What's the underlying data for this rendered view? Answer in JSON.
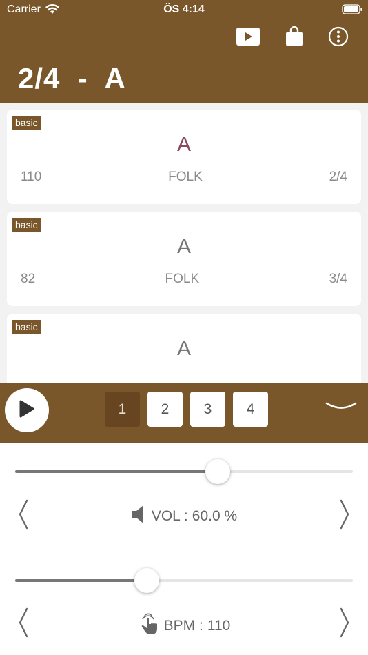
{
  "status": {
    "carrier": "Carrier",
    "time": "ÖS 4:14"
  },
  "header": {
    "title": "2/4  -  A",
    "icons": [
      "video-play-icon",
      "shopping-bag-icon",
      "more-options-icon"
    ]
  },
  "rhythms": [
    {
      "tag": "basic",
      "key": "A",
      "bpm": "110",
      "genre": "FOLK",
      "meter": "2/4",
      "active": true
    },
    {
      "tag": "basic",
      "key": "A",
      "bpm": "82",
      "genre": "FOLK",
      "meter": "3/4",
      "active": false
    },
    {
      "tag": "basic",
      "key": "A",
      "bpm": "",
      "genre": "",
      "meter": "",
      "active": false
    }
  ],
  "player": {
    "beats": [
      "1",
      "2",
      "3",
      "4"
    ],
    "current_beat": 1
  },
  "volume": {
    "label": "VOL :",
    "value_text": "60.0 %",
    "level": 0.6
  },
  "tempo": {
    "label": "BPM :",
    "value_text": "110",
    "level": 0.39
  },
  "colors": {
    "brand": "#79572a",
    "beat_active": "#674520",
    "key_active": "#8a4a5f"
  }
}
